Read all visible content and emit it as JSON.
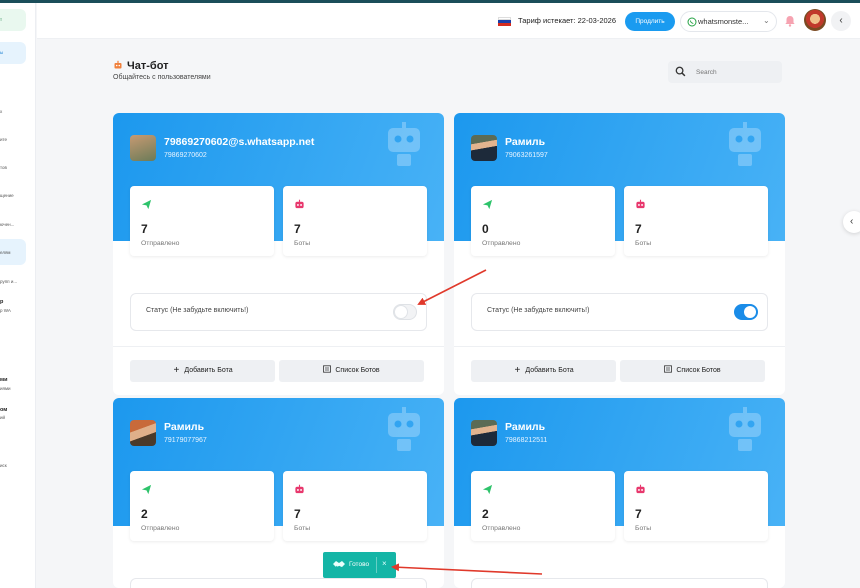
{
  "header": {
    "tariff_text": "Тариф истекает: 22-03-2026",
    "renew_label": "Продлить",
    "account_name": "whatsmonste...",
    "flag_colors": [
      "#ffffff",
      "#1c3fa8",
      "#d52b1e"
    ]
  },
  "sidebar": {
    "items": [
      "т",
      "ы",
      "х",
      "ите",
      "тов",
      "щение",
      "ючен...",
      "елям",
      "рупп и...",
      "р",
      "р WA",
      "ми",
      "иями",
      "ом",
      "ий",
      "иск"
    ],
    "accent_green": "#e9f8ef",
    "accent_blue": "#e6f3fd"
  },
  "page": {
    "title": "Чат-бот",
    "subtitle": "Общайтесь с пользователями",
    "search_placeholder": "Search"
  },
  "cards": [
    {
      "name": "79869270602@s.whatsapp.net",
      "number": "79869270602",
      "sent_value": "7",
      "sent_label": "Отправлено",
      "bots_value": "7",
      "bots_label": "Боты",
      "status_label": "Статус (Не забудьте включить!)",
      "status_on": false,
      "add_label": "Добавить Бота",
      "list_label": "Список Ботов"
    },
    {
      "name": "Рамиль",
      "number": "79063261597",
      "sent_value": "0",
      "sent_label": "Отправлено",
      "bots_value": "7",
      "bots_label": "Боты",
      "status_label": "Статус (Не забудьте включить!)",
      "status_on": true,
      "add_label": "Добавить Бота",
      "list_label": "Список Ботов"
    },
    {
      "name": "Рамиль",
      "number": "79179077967",
      "sent_value": "2",
      "sent_label": "Отправлено",
      "bots_value": "7",
      "bots_label": "Боты"
    },
    {
      "name": "Рамиль",
      "number": "79868212511",
      "sent_value": "2",
      "sent_label": "Отправлено",
      "bots_value": "7",
      "bots_label": "Боты"
    }
  ],
  "toast": {
    "text": "Готово",
    "close": "×"
  },
  "colors": {
    "primary": "#1a9bf0",
    "toast": "#14b5a6",
    "arrow": "#e0392b",
    "sent_icon": "#2ec36b",
    "bot_icon": "#e8386d"
  }
}
